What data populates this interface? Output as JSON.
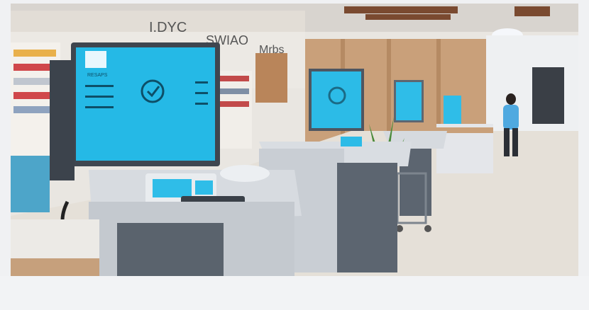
{
  "image": {
    "subject": "self-checkout-kiosks-in-store",
    "store_signs": [
      "I.DYC",
      "SWIAO",
      "Mrbs"
    ],
    "kiosk_screen_heading": "RESAPS"
  },
  "palette": {
    "screen": "#25b9e6",
    "kiosk_body": "#d9dde2",
    "kiosk_dark": "#5c6570",
    "floor": "#e7e2da",
    "wood": "#c8a27d",
    "person_top": "#4fa9e0"
  }
}
